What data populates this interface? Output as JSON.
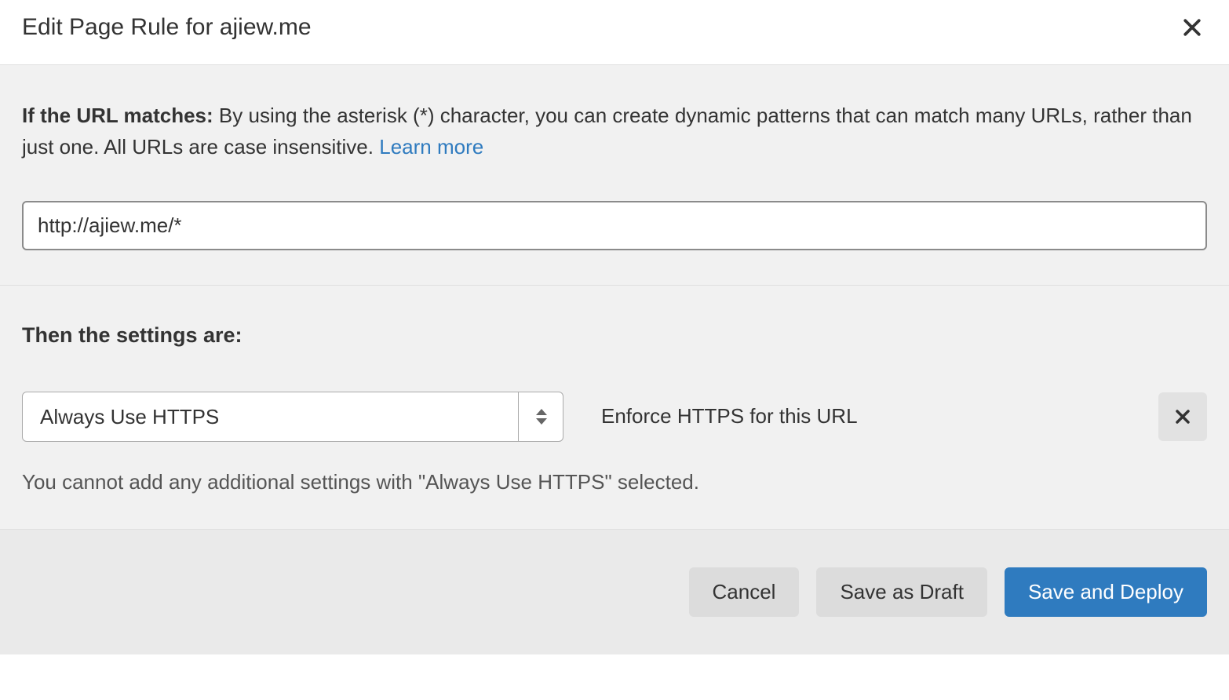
{
  "header": {
    "title": "Edit Page Rule for ajiew.me"
  },
  "url_section": {
    "label_bold": "If the URL matches:",
    "description": "By using the asterisk (*) character, you can create dynamic patterns that can match many URLs, rather than just one. All URLs are case insensitive.",
    "learn_more": "Learn more",
    "input_value": "http://ajiew.me/*"
  },
  "settings_section": {
    "heading": "Then the settings are:",
    "select_value": "Always Use HTTPS",
    "setting_description": "Enforce HTTPS for this URL",
    "note": "You cannot add any additional settings with \"Always Use HTTPS\" selected."
  },
  "footer": {
    "cancel": "Cancel",
    "save_draft": "Save as Draft",
    "save_deploy": "Save and Deploy"
  }
}
